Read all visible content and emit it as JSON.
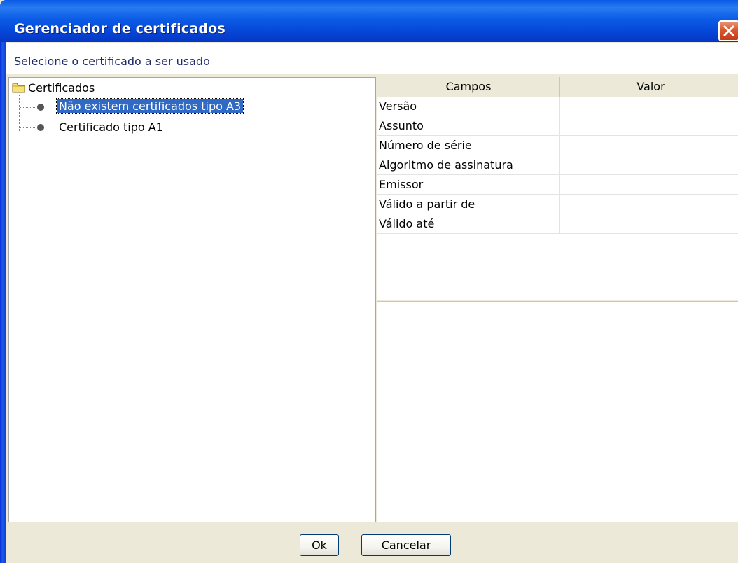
{
  "window": {
    "title": "Gerenciador de certificados"
  },
  "instruction": "Selecione o certificado a ser usado",
  "tree": {
    "root_label": "Certificados",
    "items": [
      {
        "label": "Não existem certificados tipo A3",
        "selected": true
      },
      {
        "label": "Certificado tipo A1",
        "selected": false
      }
    ]
  },
  "details_table": {
    "columns": [
      "Campos",
      "Valor"
    ],
    "rows": [
      {
        "field": "Versão",
        "value": ""
      },
      {
        "field": "Assunto",
        "value": ""
      },
      {
        "field": "Número de série",
        "value": ""
      },
      {
        "field": "Algoritmo de assinatura",
        "value": ""
      },
      {
        "field": "Emissor",
        "value": ""
      },
      {
        "field": "Válido a partir de",
        "value": ""
      },
      {
        "field": "Válido até",
        "value": ""
      }
    ]
  },
  "buttons": {
    "ok_label": "Ok",
    "cancel_label": "Cancelar"
  },
  "colors": {
    "titlebar": "#0b5ce6",
    "selection": "#316ac5",
    "close_button": "#d9582e"
  },
  "icons": {
    "close": "close-icon",
    "folder": "folder-icon",
    "bullet": "bullet-icon"
  }
}
